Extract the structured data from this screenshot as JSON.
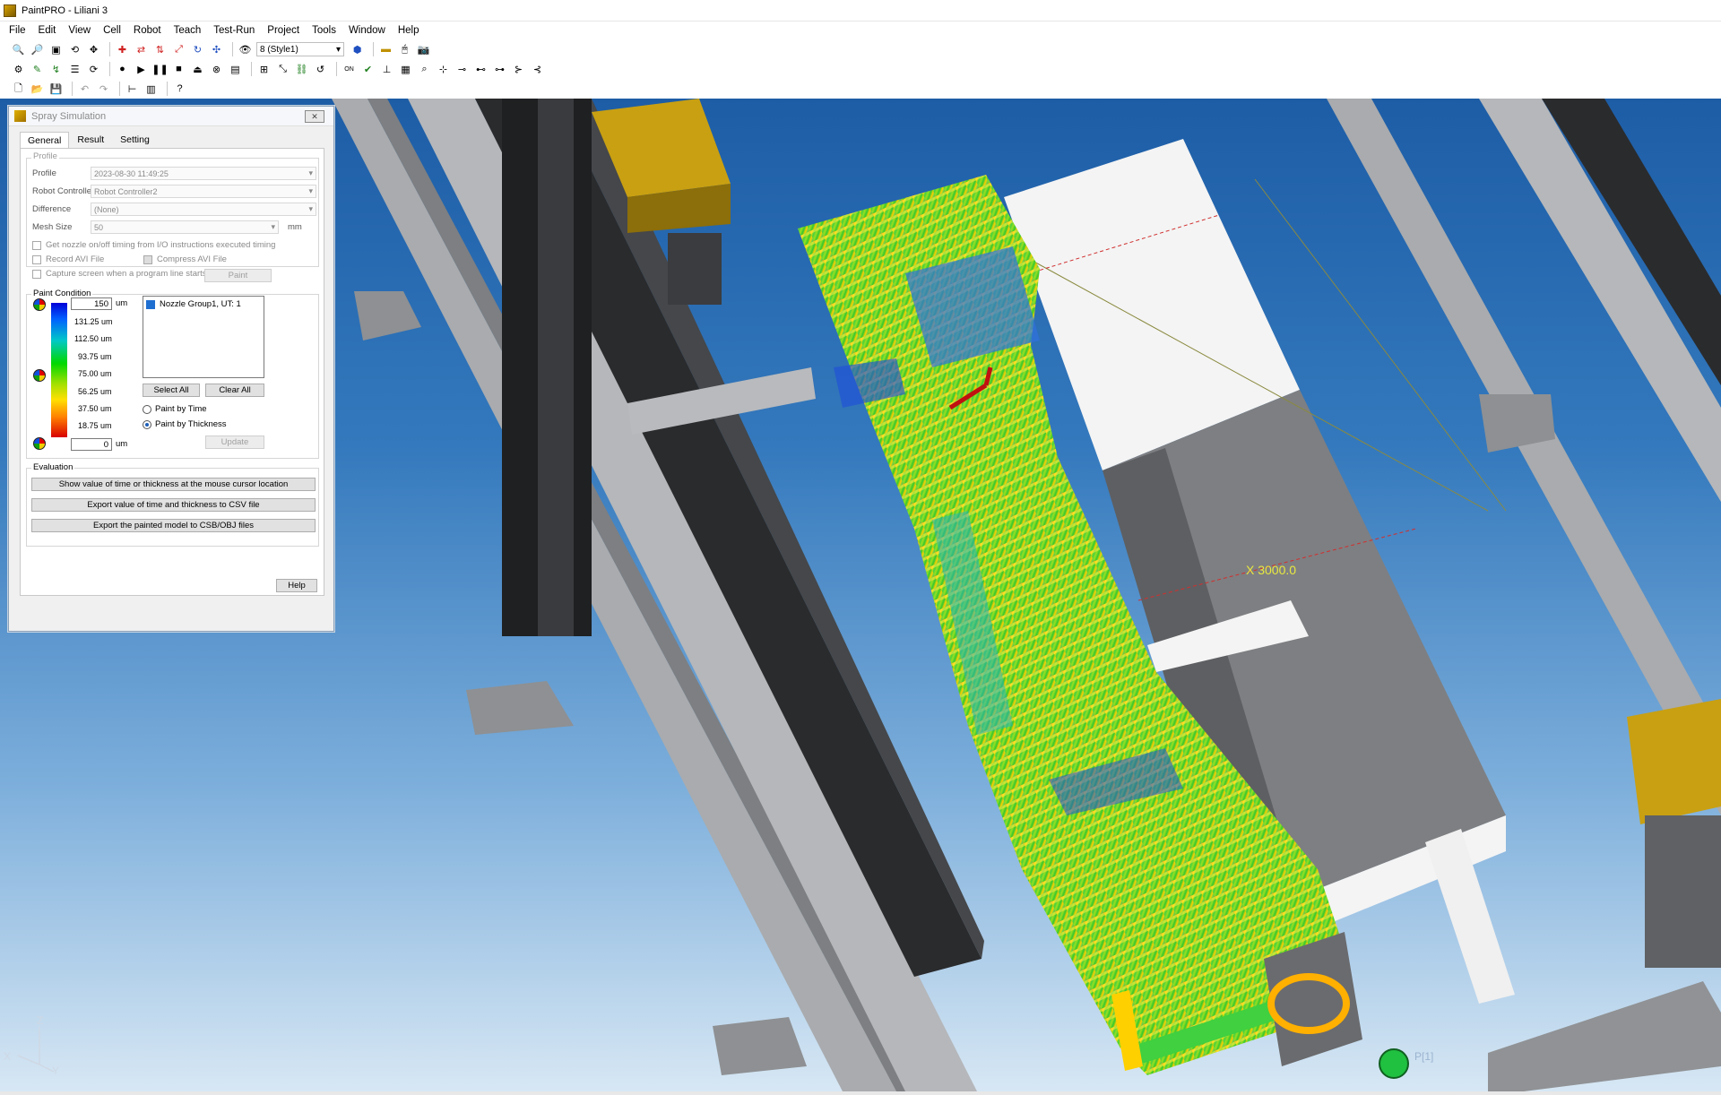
{
  "window": {
    "title": "PaintPRO - Liliani 3"
  },
  "menu": [
    "File",
    "Edit",
    "View",
    "Cell",
    "Robot",
    "Teach",
    "Test-Run",
    "Project",
    "Tools",
    "Window",
    "Help"
  ],
  "toolbar": {
    "style_combo": "8 (Style1)"
  },
  "dialog": {
    "title": "Spray Simulation",
    "close_label": "✕",
    "tabs": [
      "General",
      "Result",
      "Setting"
    ],
    "profile_group": {
      "label": "Profile",
      "profile_label": "Profile",
      "profile_value": "2023-08-30 11:49:25",
      "controller_label": "Robot Controller",
      "controller_value": "Robot Controller2",
      "difference_label": "Difference",
      "difference_value": "(None)",
      "mesh_label": "Mesh Size",
      "mesh_value": "50",
      "mesh_unit": "mm",
      "chk_nozzle": "Get nozzle on/off timing from I/O instructions executed timing",
      "chk_record": "Record AVI File",
      "chk_compress": "Compress AVI File",
      "chk_capture": "Capture screen when a program line starts",
      "paint_button": "Paint"
    },
    "paint_condition": {
      "label": "Paint Condition",
      "max_value": "150",
      "min_value": "0",
      "unit": "um",
      "ticks": [
        "131.25 um",
        "112.50 um",
        "93.75 um",
        "75.00 um",
        "56.25 um",
        "37.50 um",
        "18.75 um"
      ],
      "nozzle_item": "Nozzle Group1, UT: 1",
      "select_all": "Select All",
      "clear_all": "Clear All",
      "radio_time": "Paint by Time",
      "radio_thickness": "Paint by Thickness",
      "update": "Update"
    },
    "evaluation": {
      "label": "Evaluation",
      "btn_show": "Show value of time or thickness at the mouse cursor location",
      "btn_export_csv": "Export value of time and thickness to CSV file",
      "btn_export_model": "Export the painted model to CSB/OBJ files"
    },
    "help": "Help"
  },
  "viewport": {
    "readout": "X 3000.0",
    "axis_z": "Z",
    "axis_x": "X",
    "axis_y": "Y",
    "robot_label": "P[1]"
  }
}
